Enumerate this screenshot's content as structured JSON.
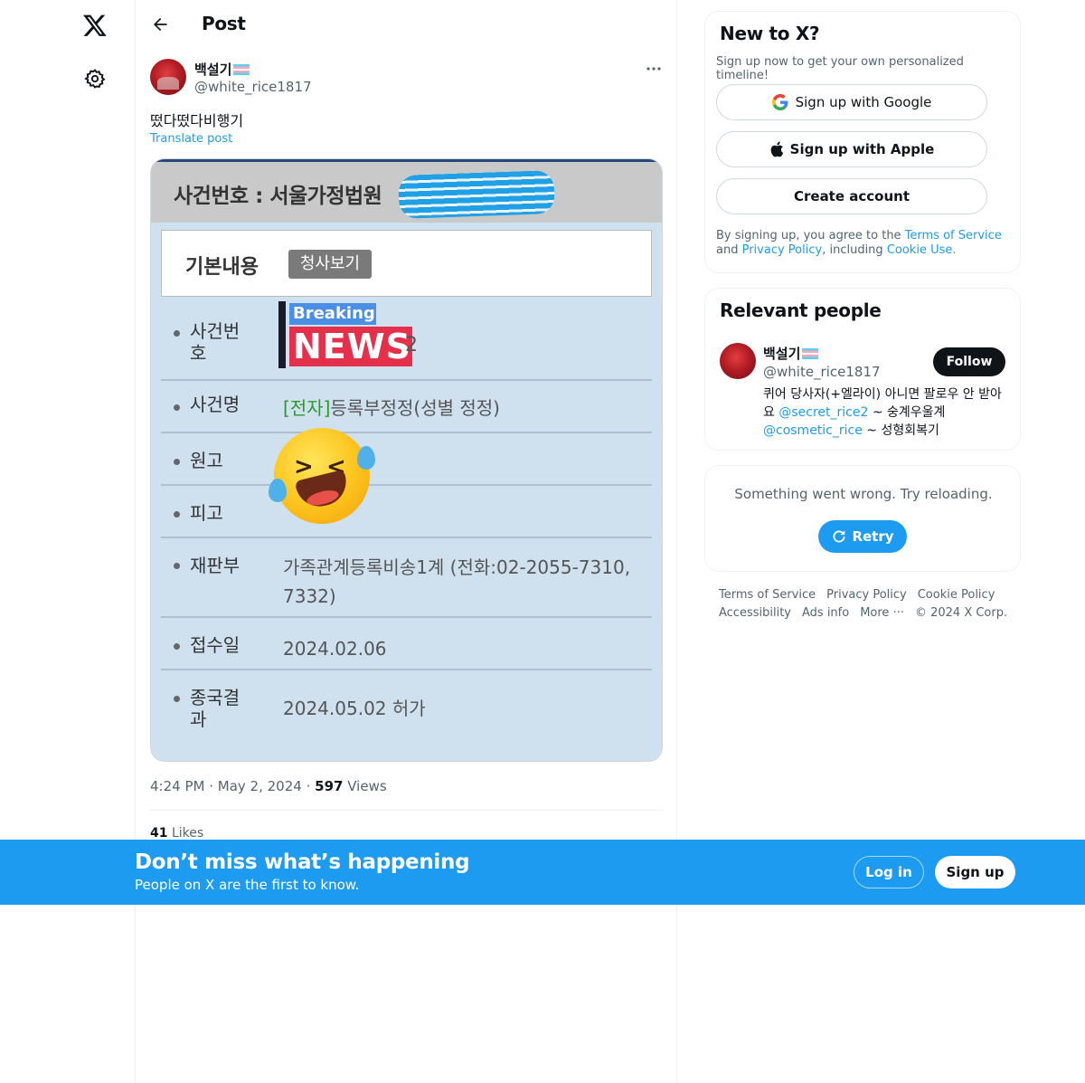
{
  "nav": {
    "logo_icon": "x-logo-icon",
    "settings_icon": "gear-icon"
  },
  "header": {
    "back_icon": "arrow-left-icon",
    "title": "Post"
  },
  "post": {
    "author_name": "백설기",
    "author_handle": "@white_rice1817",
    "more_icon": "more-dots-icon",
    "text": "떴다떴다비행기",
    "translate_label": "Translate post",
    "media": {
      "header_text": "사건번호 : 서울가정법원",
      "basic_label": "기본내용",
      "basic_button": "청사보기",
      "news_breaking": "Breaking",
      "news_word": "NEWS",
      "news_tail": "2",
      "rows": [
        {
          "label_line1": "사건번",
          "label_line2": "호",
          "value": ""
        },
        {
          "label_line1": "사건명",
          "label_line2": "",
          "value_green": "[전자]",
          "value": "등록부정정(성별 정정)"
        },
        {
          "label_line1": "원고",
          "label_line2": "",
          "value": ""
        },
        {
          "label_line1": "피고",
          "label_line2": "",
          "value": ""
        },
        {
          "label_line1": "재판부",
          "label_line2": "",
          "value": "가족관계등록비송1계 (전화:02-2055-7310,",
          "value2": "7332)"
        },
        {
          "label_line1": "접수일",
          "label_line2": "",
          "value": "2024.02.06"
        },
        {
          "label_line1": "종국결",
          "label_line2": "과",
          "value": "2024.05.02 허가"
        }
      ]
    },
    "time": "4:24 PM",
    "date": "May 2, 2024",
    "views_count": "597",
    "views_label": "Views",
    "likes_count": "41",
    "likes_label": "Likes"
  },
  "sidebar": {
    "newx": {
      "title": "New to X?",
      "subtitle": "Sign up now to get your own personalized timeline!",
      "google_label": "Sign up with Google",
      "apple_label": "Sign up with Apple",
      "create_label": "Create account",
      "terms_prefix": "By signing up, you agree to the ",
      "terms_link": "Terms of Service",
      "terms_and": " and ",
      "privacy_link": "Privacy Policy",
      "terms_including": ", including ",
      "cookie_link": "Cookie Use",
      "terms_end": "."
    },
    "relevant": {
      "title": "Relevant people",
      "name": "백설기",
      "handle": "@white_rice1817",
      "follow_label": "Follow",
      "bio_part1": "퀴어 당사자(+엘라이) 아니면 팔로우 안 받아요 ",
      "bio_link1": "@secret_rice2",
      "bio_part2": " ~ 숭계우울계 ",
      "bio_link2": "@cosmetic_rice",
      "bio_part3": " ~ 성형회복기"
    },
    "error": {
      "text": "Something went wrong. Try reloading.",
      "retry_label": "Retry"
    },
    "footer": {
      "links": [
        "Terms of Service",
        "Privacy Policy",
        "Cookie Policy",
        "Accessibility",
        "Ads info",
        "More ···",
        "© 2024 X Corp."
      ]
    }
  },
  "banner": {
    "title": "Don’t miss what’s happening",
    "subtitle": "People on X are the first to know.",
    "login_label": "Log in",
    "signup_label": "Sign up"
  },
  "colors": {
    "accent": "#1d9bf0",
    "text": "#0f1419",
    "secondary": "#536471"
  }
}
